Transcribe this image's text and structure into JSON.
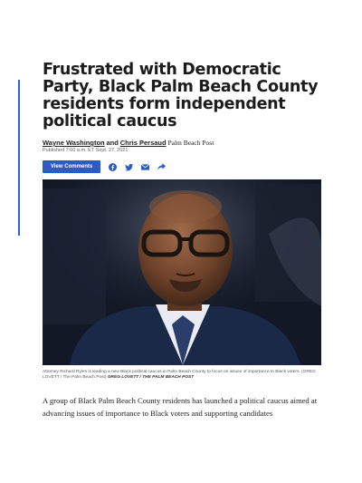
{
  "article": {
    "headline": "Frustrated with Democratic Party, Black Palm Beach County residents form independent political caucus",
    "authors": [
      "Wayne Washington",
      "Chris Persaud"
    ],
    "author_joiner": "and",
    "publication": "Palm Beach Post",
    "published": "Published 7:00 a.m. ET Sept. 27, 2021",
    "view_comments_label": "View Comments",
    "share_icons": [
      "facebook-icon",
      "twitter-icon",
      "email-icon",
      "share-arrow-icon"
    ],
    "caption": "Attorney Richard Ryles is leading a new Black political caucus in Palm Beach County to focus on issues of importance to Black voters. (GREG LOVETT / The Palm Beach Post)",
    "photo_credit": "GREG LOVETT / THE PALM BEACH POST",
    "body": "A group of Black Palm Beach County residents has launched a political caucus aimed at advancing issues of importance to Black voters and supporting candidates"
  },
  "colors": {
    "accent": "#2b5cc4",
    "rule": "#2f63c4"
  }
}
